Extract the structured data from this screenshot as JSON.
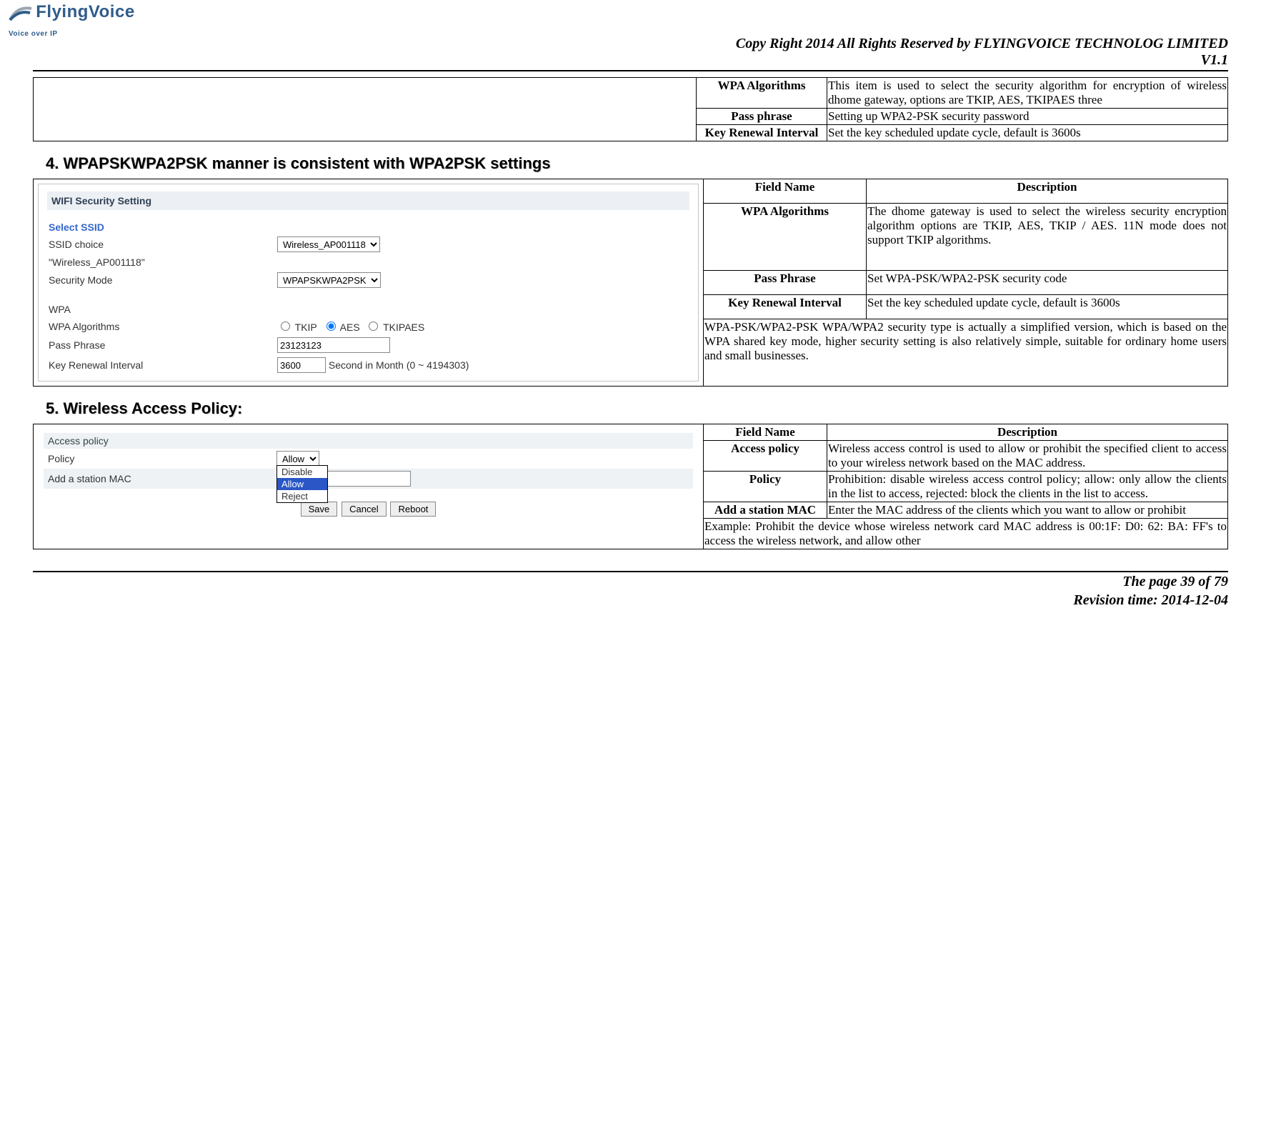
{
  "header": {
    "logo_name": "FlyingVoice",
    "logo_tagline": "Voice over IP",
    "copyright": "Copy Right 2014 All Rights Reserved by FLYINGVOICE TECHNOLOG LIMITED",
    "version": "V1.1"
  },
  "table1": {
    "rows": [
      {
        "field": "WPA Algorithms",
        "desc": "This item is used to select the security algorithm for encryption of wireless dhome gateway, options are TKIP, AES, TKIPAES three"
      },
      {
        "field": "Pass phrase",
        "desc": "Setting up WPA2-PSK security password"
      },
      {
        "field": "Key Renewal Interval",
        "desc": "Set the key scheduled update cycle, default is 3600s"
      }
    ]
  },
  "section4": {
    "heading": "4.  WPAPSKWPA2PSK manner is consistent with WPA2PSK settings",
    "shot": {
      "title": "WIFI Security Setting",
      "ssid_head": "Select SSID",
      "ssid_choice_label": "SSID choice",
      "ssid_choice_value": "Wireless_AP001118",
      "ssid_quoted": "\"Wireless_AP001118\"",
      "mode_label": "Security Mode",
      "mode_value": "WPAPSKWPA2PSK",
      "wpa_head": "WPA",
      "alg_label": "WPA Algorithms",
      "alg_opts": [
        "TKIP",
        "AES",
        "TKIPAES"
      ],
      "alg_selected": "AES",
      "pass_label": "Pass Phrase",
      "pass_value": "23123123",
      "renew_label": "Key Renewal Interval",
      "renew_value": "3600",
      "renew_suffix": "Second in Month   (0 ~ 4194303)"
    },
    "desc_header_field": "Field Name",
    "desc_header_desc": "Description",
    "rows": [
      {
        "field": "WPA Algorithms",
        "desc": "The dhome gateway is used to select the wireless security encryption algorithm options are TKIP, AES, TKIP / AES. 11N mode does not support TKIP algorithms."
      },
      {
        "field": "Pass Phrase",
        "desc": "Set WPA-PSK/WPA2-PSK security code"
      },
      {
        "field": "Key Renewal Interval",
        "desc": "Set the key scheduled update cycle, default is 3600s"
      }
    ],
    "note": "WPA-PSK/WPA2-PSK WPA/WPA2 security type is actually a simplified version, which is based on the WPA shared key mode, higher security setting is also relatively simple, suitable for ordinary home users and small businesses."
  },
  "section5": {
    "heading": "5.  Wireless Access Policy:",
    "shot": {
      "title": "Access policy",
      "policy_label": "Policy",
      "policy_selected": "Allow",
      "policy_opts": [
        "Disable",
        "Allow",
        "Reject"
      ],
      "mac_label": "Add a station MAC",
      "mac_value": "",
      "btn_save": "Save",
      "btn_cancel": "Cancel",
      "btn_reboot": "Reboot"
    },
    "desc_header_field": "Field Name",
    "desc_header_desc": "Description",
    "rows": [
      {
        "field": "Access policy",
        "desc": "Wireless access control is used to allow or prohibit the specified client to access to your wireless network based on the MAC address."
      },
      {
        "field": "Policy",
        "desc": "Prohibition: disable wireless access control policy; allow: only allow the clients in the list to access, rejected: block the clients in the list to access."
      },
      {
        "field": "Add a station MAC",
        "desc": "Enter the MAC address of the clients which you want to allow or prohibit"
      }
    ],
    "note": "Example: Prohibit the device whose wireless network card MAC address is 00:1F: D0: 62: BA: FF's to access the wireless network, and allow other"
  },
  "footer": {
    "page": "The page 39 of 79",
    "revision": "Revision time: 2014-12-04"
  }
}
